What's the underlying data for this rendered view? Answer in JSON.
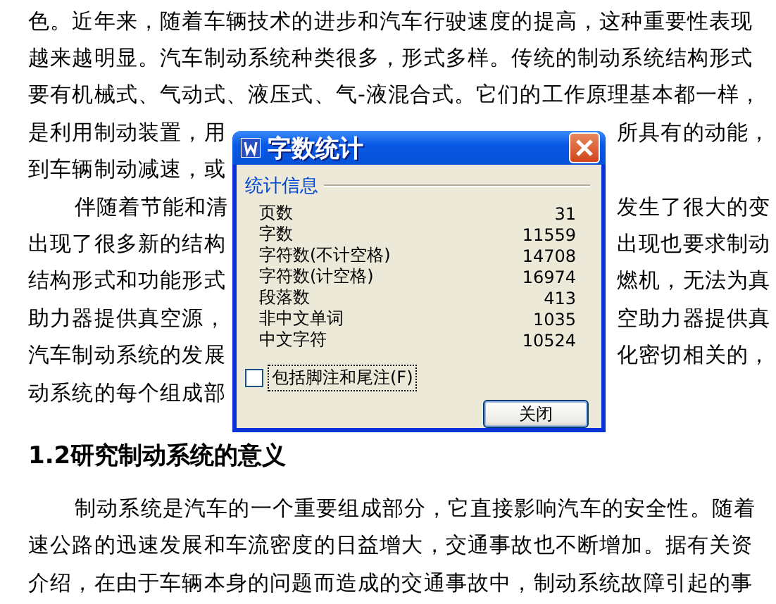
{
  "document": {
    "lines": [
      {
        "left": "色。近年来，随着车辆技术的进步和汽车行驶速度的提高，这种重要性表现",
        "indent": false
      },
      {
        "left": "越来越明显。汽车制动系统种类很多，形式多样。传统的制动系统结构形式",
        "indent": false
      },
      {
        "left": "要有机械式、气动式、液压式、气-液混合式。它们的工作原理基本都一样，",
        "indent": false
      },
      {
        "left": "是利用制动装置，用",
        "right": "所具有的动能，",
        "indent": false
      },
      {
        "left": "到车辆制动减速，或",
        "indent": false
      },
      {
        "left": "伴随着节能和清",
        "right": "发生了很大的变",
        "indent": true
      },
      {
        "left": "出现了很多新的结构",
        "right": "出现也要求制动",
        "indent": false
      },
      {
        "left": "结构形式和功能形式",
        "right": "燃机，无法为真",
        "indent": false
      },
      {
        "left": "助力器提供真空源，",
        "right": "空助力器提供真",
        "indent": false
      },
      {
        "left": "汽车制动系统的发展",
        "right": "化密切相关的，",
        "indent": false
      },
      {
        "left": "动系统的每个组成部",
        "indent": false
      }
    ],
    "heading": "1.2研究制动系统的意义",
    "paragraph": [
      {
        "left": "制动系统是汽车的一个重要组成部分，它直接影响汽车的安全性。随着",
        "indent": true
      },
      {
        "left": "速公路的迅速发展和车流密度的日益增大，交通事故也不断增加。据有关资",
        "indent": false
      },
      {
        "left": "介绍，在由于车辆本身的问题而造成的交通事故中，制动系统故障引起的事",
        "indent": false
      }
    ]
  },
  "dialog": {
    "title": "字数统计",
    "group": "统计信息",
    "stats": [
      {
        "label": "页数",
        "value": "31"
      },
      {
        "label": "字数",
        "value": "11559"
      },
      {
        "label": "字符数(不计空格)",
        "value": "14708"
      },
      {
        "label": "字符数(计空格)",
        "value": "16974"
      },
      {
        "label": "段落数",
        "value": "413"
      },
      {
        "label": "非中文单词",
        "value": "1035"
      },
      {
        "label": "中文字符",
        "value": "10524"
      }
    ],
    "checkbox": {
      "label": "包括脚注和尾注(F)",
      "checked": false
    },
    "button": "关闭"
  }
}
